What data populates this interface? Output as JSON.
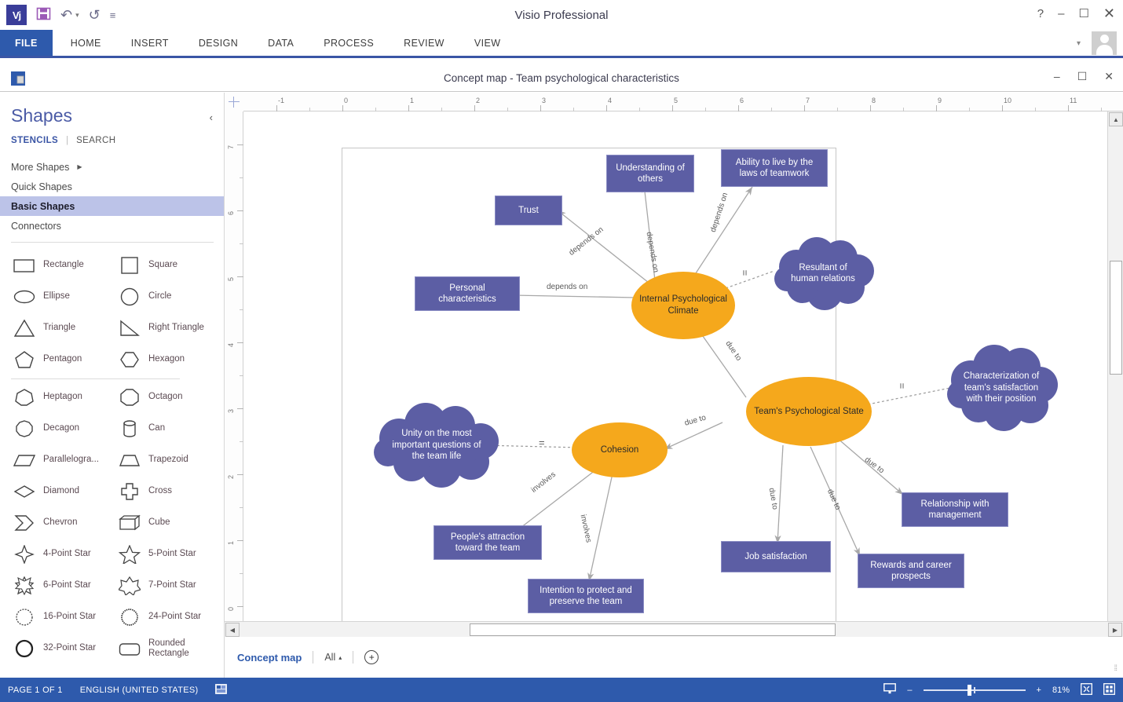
{
  "window": {
    "app_title": "Visio Professional",
    "doc_title": "Concept map - Team psychological characteristics",
    "app_logo": "Vj",
    "help_glyph": "?",
    "minimize_glyph": "–",
    "restore_glyph": "☐",
    "close_glyph": "✕",
    "doc_minimize": "–",
    "doc_restore": "☐",
    "doc_close": "✕",
    "ribbon_caret": "▾"
  },
  "qat": {
    "save": "save-icon",
    "undo": "↶",
    "undo_caret": "▾",
    "redo": "↺",
    "more": "≡"
  },
  "ribbon": {
    "tabs": [
      {
        "label": "FILE",
        "active": true
      },
      {
        "label": "HOME",
        "active": false
      },
      {
        "label": "INSERT",
        "active": false
      },
      {
        "label": "DESIGN",
        "active": false
      },
      {
        "label": "DATA",
        "active": false
      },
      {
        "label": "PROCESS",
        "active": false
      },
      {
        "label": "REVIEW",
        "active": false
      },
      {
        "label": "VIEW",
        "active": false
      }
    ]
  },
  "shapes_panel": {
    "title": "Shapes",
    "collapse_glyph": "‹",
    "stencils_label": "STENCILS",
    "divider": "|",
    "search_label": "SEARCH",
    "stencil_items": [
      {
        "label": "More Shapes",
        "arrow": "▶",
        "active": false
      },
      {
        "label": "Quick Shapes",
        "arrow": "",
        "active": false
      },
      {
        "label": "Basic Shapes",
        "arrow": "",
        "active": true
      },
      {
        "label": "Connectors",
        "arrow": "",
        "active": false
      }
    ],
    "shapes": [
      {
        "label": "Rectangle",
        "icon": "rectangle-icon"
      },
      {
        "label": "Square",
        "icon": "square-icon"
      },
      {
        "label": "Ellipse",
        "icon": "ellipse-icon"
      },
      {
        "label": "Circle",
        "icon": "circle-icon"
      },
      {
        "label": "Triangle",
        "icon": "triangle-icon"
      },
      {
        "label": "Right Triangle",
        "icon": "right-triangle-icon"
      },
      {
        "label": "Pentagon",
        "icon": "pentagon-icon"
      },
      {
        "label": "Hexagon",
        "icon": "hexagon-icon"
      },
      {
        "label": "Heptagon",
        "icon": "heptagon-icon"
      },
      {
        "label": "Octagon",
        "icon": "octagon-icon"
      },
      {
        "label": "Decagon",
        "icon": "decagon-icon"
      },
      {
        "label": "Can",
        "icon": "can-icon"
      },
      {
        "label": "Parallelogra...",
        "icon": "parallelogram-icon"
      },
      {
        "label": "Trapezoid",
        "icon": "trapezoid-icon"
      },
      {
        "label": "Diamond",
        "icon": "diamond-icon"
      },
      {
        "label": "Cross",
        "icon": "cross-icon"
      },
      {
        "label": "Chevron",
        "icon": "chevron-icon"
      },
      {
        "label": "Cube",
        "icon": "cube-icon"
      },
      {
        "label": "4-Point Star",
        "icon": "star-4-icon"
      },
      {
        "label": "5-Point Star",
        "icon": "star-5-icon"
      },
      {
        "label": "6-Point Star",
        "icon": "star-6-icon"
      },
      {
        "label": "7-Point Star",
        "icon": "star-7-icon"
      },
      {
        "label": "16-Point Star",
        "icon": "star-16-icon"
      },
      {
        "label": "24-Point Star",
        "icon": "star-24-icon"
      },
      {
        "label": "32-Point Star",
        "icon": "star-32-icon"
      },
      {
        "label": "Rounded Rectangle",
        "icon": "rounded-rectangle-icon"
      }
    ]
  },
  "rulers": {
    "horizontal_labels": [
      "-1",
      "0",
      "1",
      "2",
      "3",
      "4",
      "5",
      "6",
      "7",
      "8",
      "9",
      "10",
      "11"
    ],
    "vertical_labels": [
      "7",
      "6",
      "5",
      "4",
      "3",
      "2",
      "1",
      "0"
    ]
  },
  "page_tabs": {
    "current_page": "Concept map",
    "all_label": "All",
    "all_caret": "▴",
    "add_glyph": "+"
  },
  "status_bar": {
    "page_indicator": "PAGE 1 OF 1",
    "language": "ENGLISH (UNITED STATES)",
    "macro_icon": "macro-icon",
    "zoom_percent": "81%",
    "zoom_minus": "–",
    "zoom_plus": "+",
    "fit_page_icon": "fit-page-icon",
    "fit_window_icon": "fit-window-icon",
    "presentation_icon": "presentation-icon"
  },
  "diagram": {
    "title": "Concept map - Team psychological characteristics",
    "colors": {
      "box_fill": "#5C5EA4",
      "box_stroke": "#8b8dc4",
      "ellipse_fill": "#F5A81C",
      "cloud_fill": "#5C5EA4",
      "connector": "#a8a8a8"
    },
    "nodes": [
      {
        "id": "trust",
        "label": "Trust",
        "type": "box"
      },
      {
        "id": "understanding",
        "label": "Understanding of others",
        "type": "box"
      },
      {
        "id": "ability",
        "label": "Ability to live by the laws of teamwork",
        "type": "box"
      },
      {
        "id": "personal",
        "label": "Personal characteristics",
        "type": "box"
      },
      {
        "id": "ipc",
        "label": "Internal Psychological Climate",
        "type": "ellipse"
      },
      {
        "id": "resultant",
        "label": "Resultant of human relations",
        "type": "cloud"
      },
      {
        "id": "tps",
        "label": "Team's Psychological State",
        "type": "ellipse"
      },
      {
        "id": "characterization",
        "label": "Characterization of team's satisfaction with their position",
        "type": "cloud"
      },
      {
        "id": "cohesion",
        "label": "Cohesion",
        "type": "ellipse"
      },
      {
        "id": "unity",
        "label": "Unity on the most important questions of the team life",
        "type": "cloud"
      },
      {
        "id": "attraction",
        "label": "People's attraction toward the team",
        "type": "box"
      },
      {
        "id": "intention",
        "label": "Intention to protect and preserve the team",
        "type": "box"
      },
      {
        "id": "relationship",
        "label": "Relationship with management",
        "type": "box"
      },
      {
        "id": "jobsat",
        "label": "Job satisfaction",
        "type": "box"
      },
      {
        "id": "rewards",
        "label": "Rewards and career prospects",
        "type": "box"
      }
    ],
    "edges": [
      {
        "from": "ipc",
        "to": "trust",
        "label": "depends on"
      },
      {
        "from": "ipc",
        "to": "understanding",
        "label": "depends on"
      },
      {
        "from": "ipc",
        "to": "ability",
        "label": "depends on"
      },
      {
        "from": "ipc",
        "to": "personal",
        "label": "depends on"
      },
      {
        "from": "ipc",
        "to": "resultant",
        "label": "="
      },
      {
        "from": "tps",
        "to": "ipc",
        "label": "due to"
      },
      {
        "from": "tps",
        "to": "characterization",
        "label": "="
      },
      {
        "from": "tps",
        "to": "cohesion",
        "label": "due to"
      },
      {
        "from": "tps",
        "to": "relationship",
        "label": "due to"
      },
      {
        "from": "tps",
        "to": "jobsat",
        "label": "due to"
      },
      {
        "from": "tps",
        "to": "rewards",
        "label": "due to"
      },
      {
        "from": "cohesion",
        "to": "unity",
        "label": "="
      },
      {
        "from": "cohesion",
        "to": "attraction",
        "label": "involves"
      },
      {
        "from": "cohesion",
        "to": "intention",
        "label": "involves"
      }
    ],
    "edge_labels": {
      "l1": "depends on",
      "l2": "depends on",
      "l3": "depends on",
      "l4": "depends on",
      "l5": "due to",
      "l6": "due to",
      "l7": "due to",
      "l8": "due to",
      "l9": "due to",
      "l10": "due to",
      "l11": "involves",
      "l12": "involves",
      "eq1": "=",
      "eq2": "=",
      "eq3": "="
    }
  }
}
